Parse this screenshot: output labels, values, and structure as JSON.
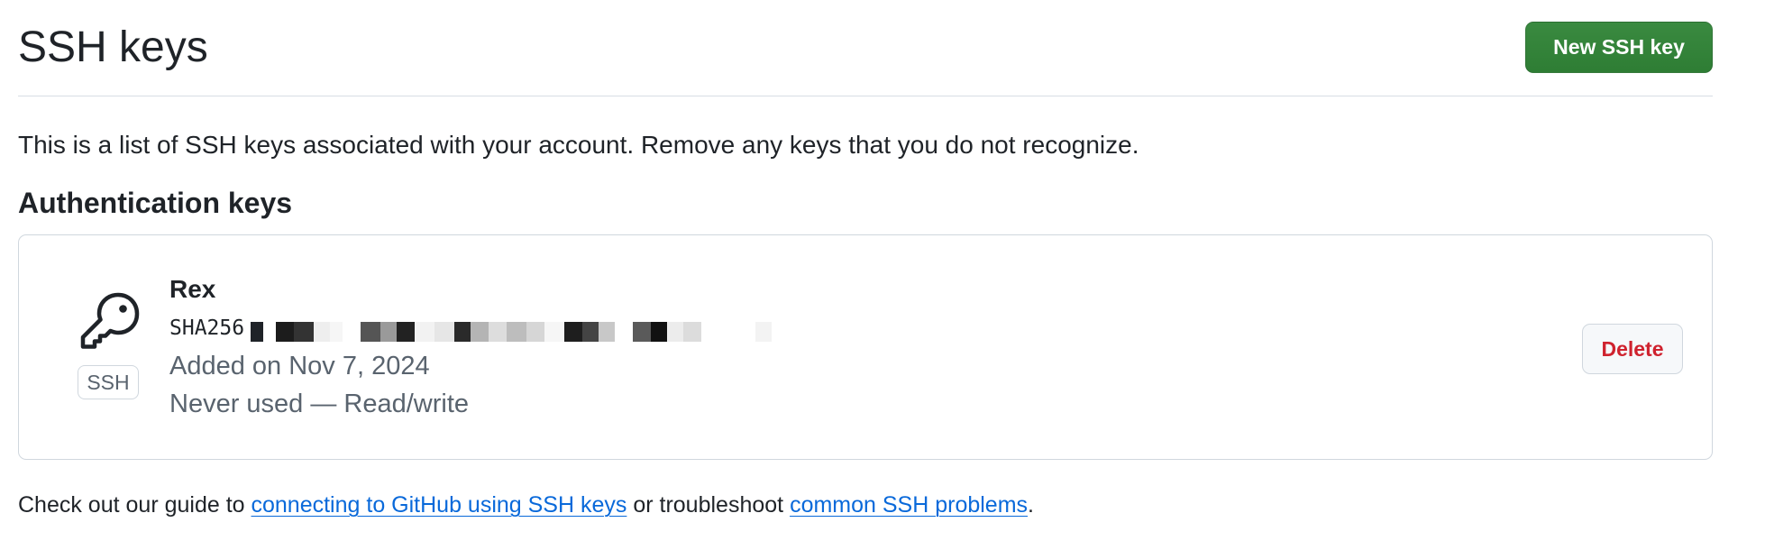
{
  "header": {
    "title": "SSH keys",
    "new_key_label": "New SSH key"
  },
  "intro_text": "This is a list of SSH keys associated with your account. Remove any keys that you do not recognize.",
  "section": {
    "title": "Authentication keys"
  },
  "key": {
    "icon": "key-icon",
    "badge": "SSH",
    "name": "Rex",
    "fingerprint_label": "SHA256",
    "fingerprint_redacted": true,
    "added": "Added on Nov 7, 2024",
    "usage": "Never used — Read/write",
    "delete_label": "Delete"
  },
  "footer": {
    "prefix": "Check out our guide to ",
    "link1": "connecting to GitHub using SSH keys",
    "middle": " or troubleshoot ",
    "link2": "common SSH problems",
    "suffix": "."
  },
  "colors": {
    "primary_button": "#2f8138",
    "danger_text": "#cf222e",
    "link": "#0969da",
    "muted_text": "#59636e",
    "border": "#d0d7de"
  }
}
